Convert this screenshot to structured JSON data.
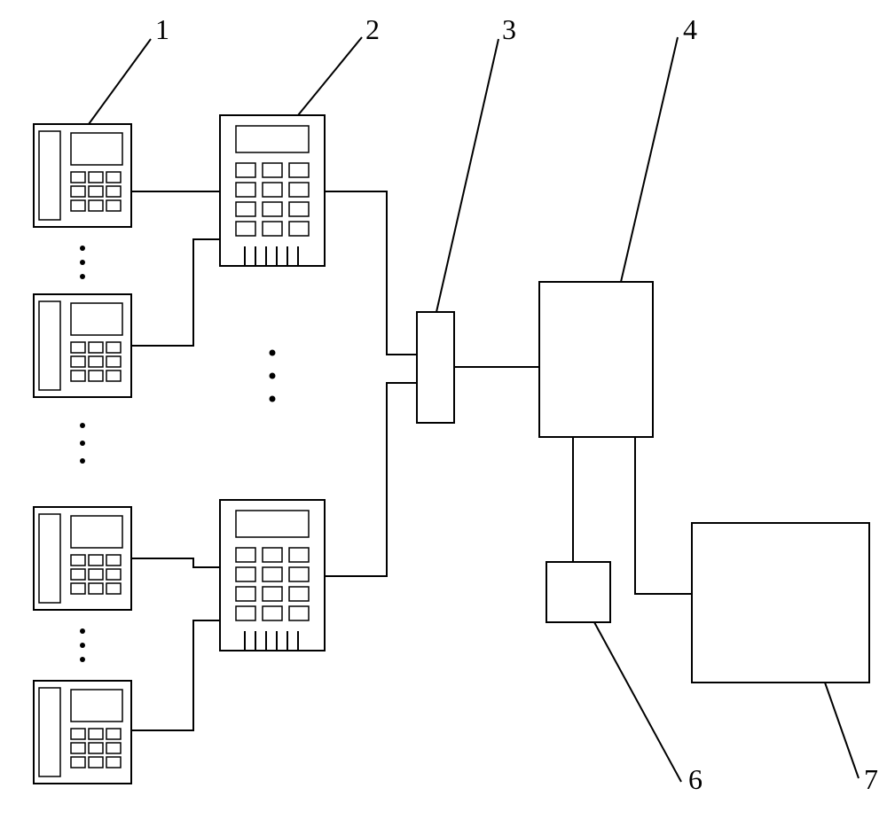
{
  "labels": {
    "n1": "1",
    "n2": "2",
    "n3": "3",
    "n4": "4",
    "n6": "6",
    "n7": "7"
  }
}
